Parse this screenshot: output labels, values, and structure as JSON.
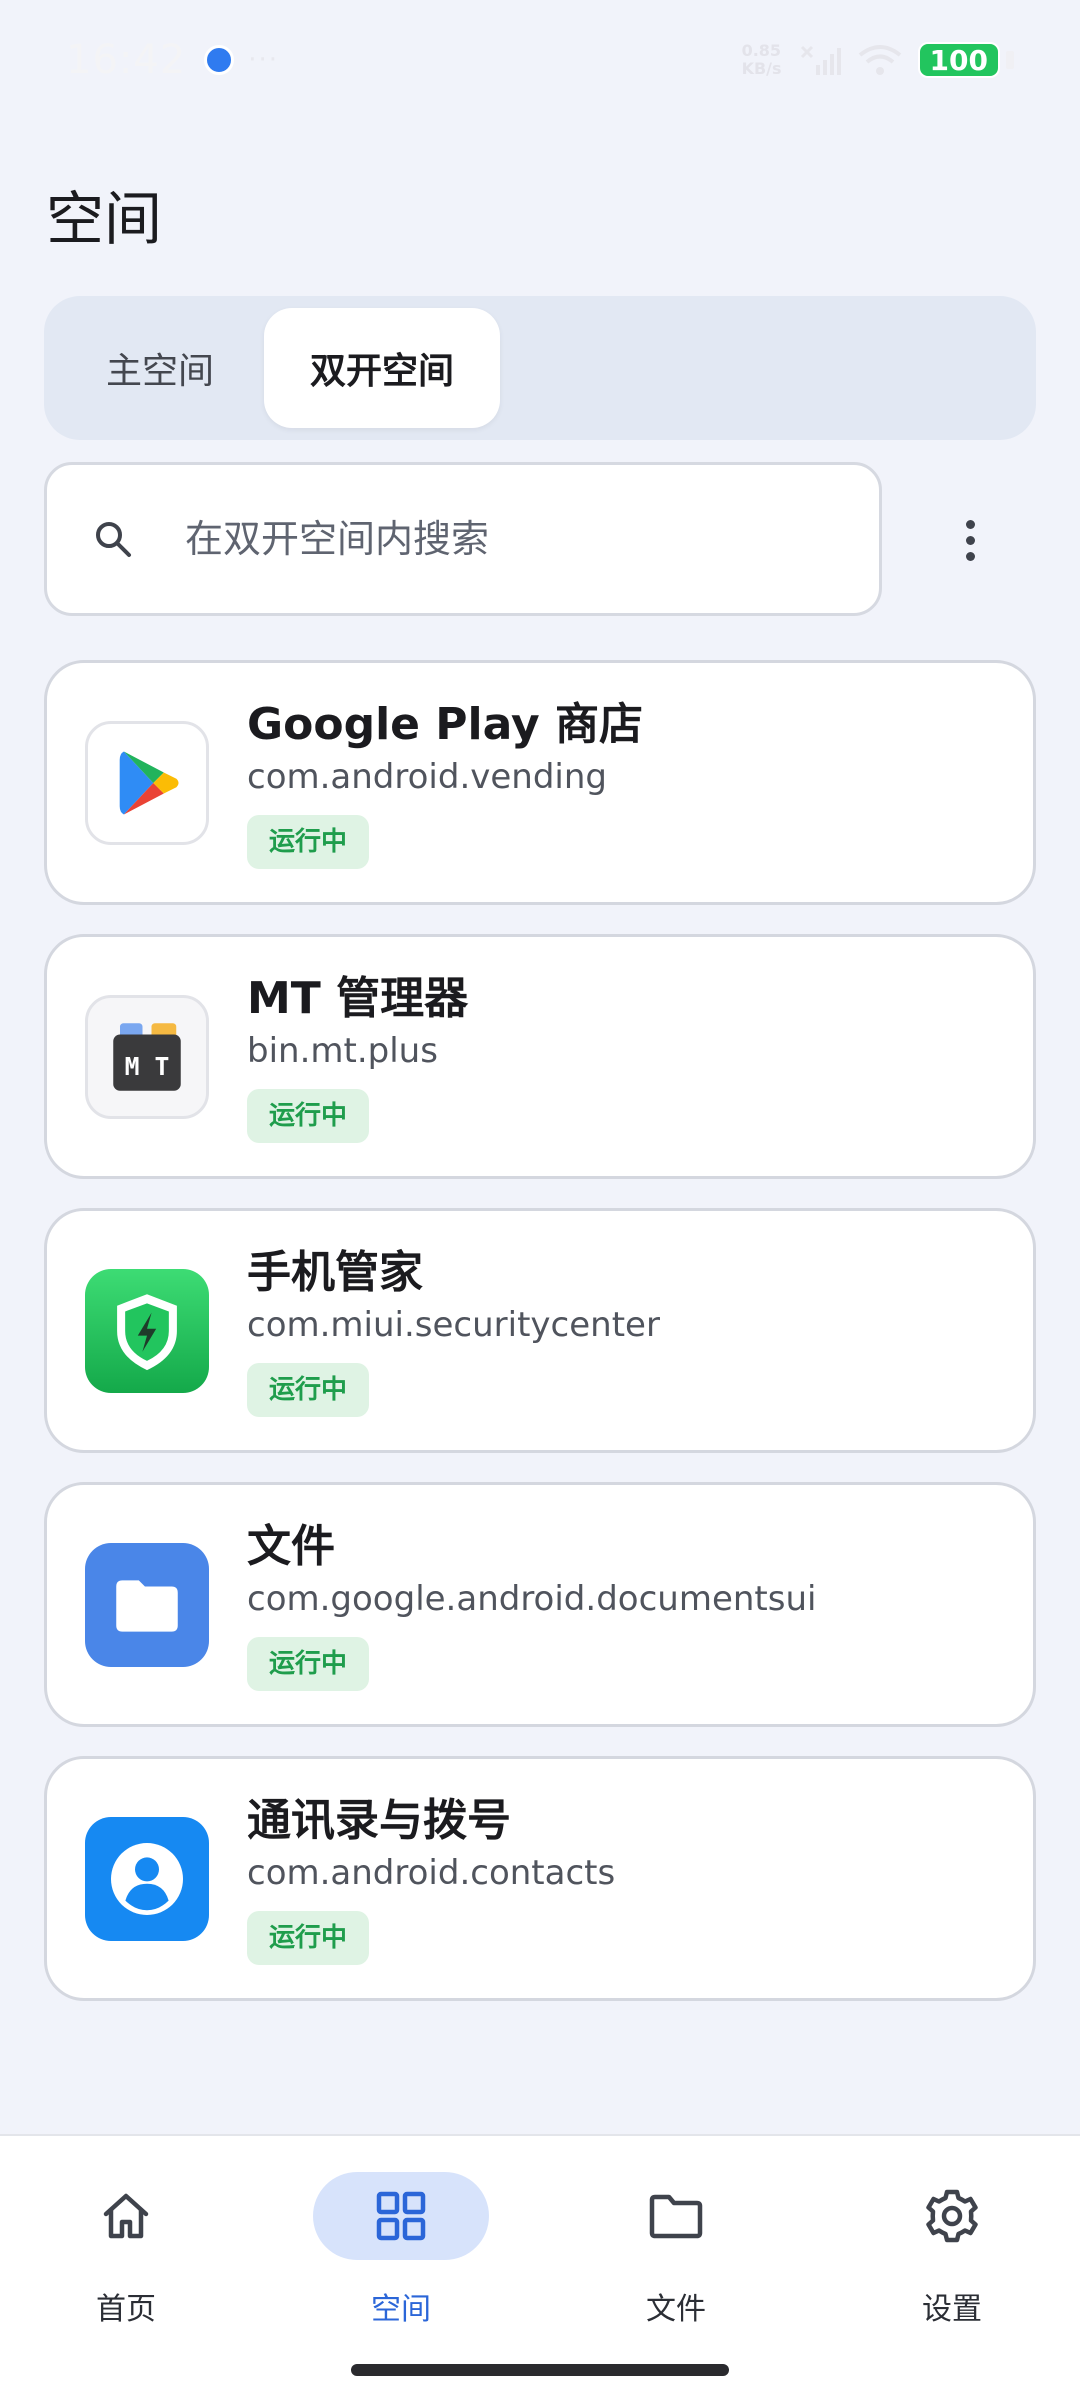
{
  "status_bar": {
    "time": "16:42",
    "dots": "···",
    "speed_value": "0.85",
    "speed_unit": "KB/s",
    "battery": "100"
  },
  "page": {
    "title": "空间"
  },
  "tabs": [
    {
      "label": "主空间",
      "selected": false
    },
    {
      "label": "双开空间",
      "selected": true
    }
  ],
  "search": {
    "placeholder": "在双开空间内搜索",
    "value": ""
  },
  "apps": [
    {
      "name": "Google Play 商店",
      "package": "com.android.vending",
      "status": "运行中",
      "icon": "google-play-icon"
    },
    {
      "name": "MT 管理器",
      "package": "bin.mt.plus",
      "status": "运行中",
      "icon": "mt-manager-icon"
    },
    {
      "name": "手机管家",
      "package": "com.miui.securitycenter",
      "status": "运行中",
      "icon": "security-shield-icon"
    },
    {
      "name": "文件",
      "package": "com.google.android.documentsui",
      "status": "运行中",
      "icon": "folder-icon"
    },
    {
      "name": "通讯录与拨号",
      "package": "com.android.contacts",
      "status": "运行中",
      "icon": "contacts-icon"
    }
  ],
  "bottom_nav": [
    {
      "label": "首页",
      "icon": "home-icon",
      "selected": false
    },
    {
      "label": "空间",
      "icon": "grid-icon",
      "selected": true
    },
    {
      "label": "文件",
      "icon": "folder-outline-icon",
      "selected": false
    },
    {
      "label": "设置",
      "icon": "gear-icon",
      "selected": false
    }
  ],
  "colors": {
    "accent": "#2b66d8",
    "status_running_bg": "#dff3e4",
    "status_running_text": "#1f9d4c",
    "background": "#f1f3fa"
  }
}
